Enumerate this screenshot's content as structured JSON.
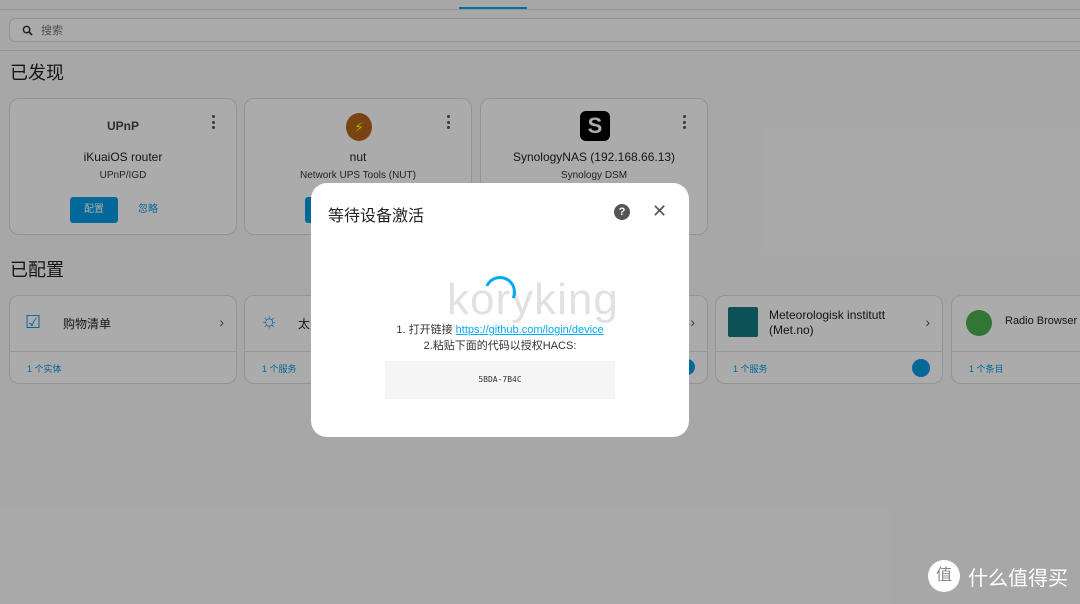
{
  "search": {
    "placeholder": "搜索"
  },
  "discovered": {
    "title": "已发现",
    "cards": [
      {
        "logo": "UPnP",
        "title": "iKuaiOS router",
        "subtitle": "UPnP/IGD",
        "configure": "配置",
        "ignore": "忽略"
      },
      {
        "logo": "nut-icon",
        "title": "nut",
        "subtitle": "Network UPS Tools (NUT)",
        "configure": "配置"
      },
      {
        "logo": "S",
        "title": "SynologyNAS (192.168.66.13)",
        "subtitle": "Synology DSM"
      }
    ]
  },
  "configured": {
    "title": "已配置",
    "cards": [
      {
        "name": "购物清单",
        "footer": "1 个实体"
      },
      {
        "name": "太",
        "footer": "1 个服务"
      },
      {
        "name": "",
        "footer": ""
      },
      {
        "name": "Meteorologisk institutt (Met.no)",
        "footer": "1 个服务"
      },
      {
        "name": "Radio Browser",
        "footer": "1 个条目"
      }
    ]
  },
  "dialog": {
    "title": "等待设备激活",
    "step1_prefix": "1. 打开链接 ",
    "step1_link": "https://github.com/login/device",
    "step2": "2.粘贴下面的代码以授权HACS:",
    "code": "5BDA-7B4C"
  },
  "watermark": "koryking",
  "brand": {
    "logo": "值",
    "text": "什么值得买"
  },
  "colors": {
    "accent": "#039be5"
  }
}
